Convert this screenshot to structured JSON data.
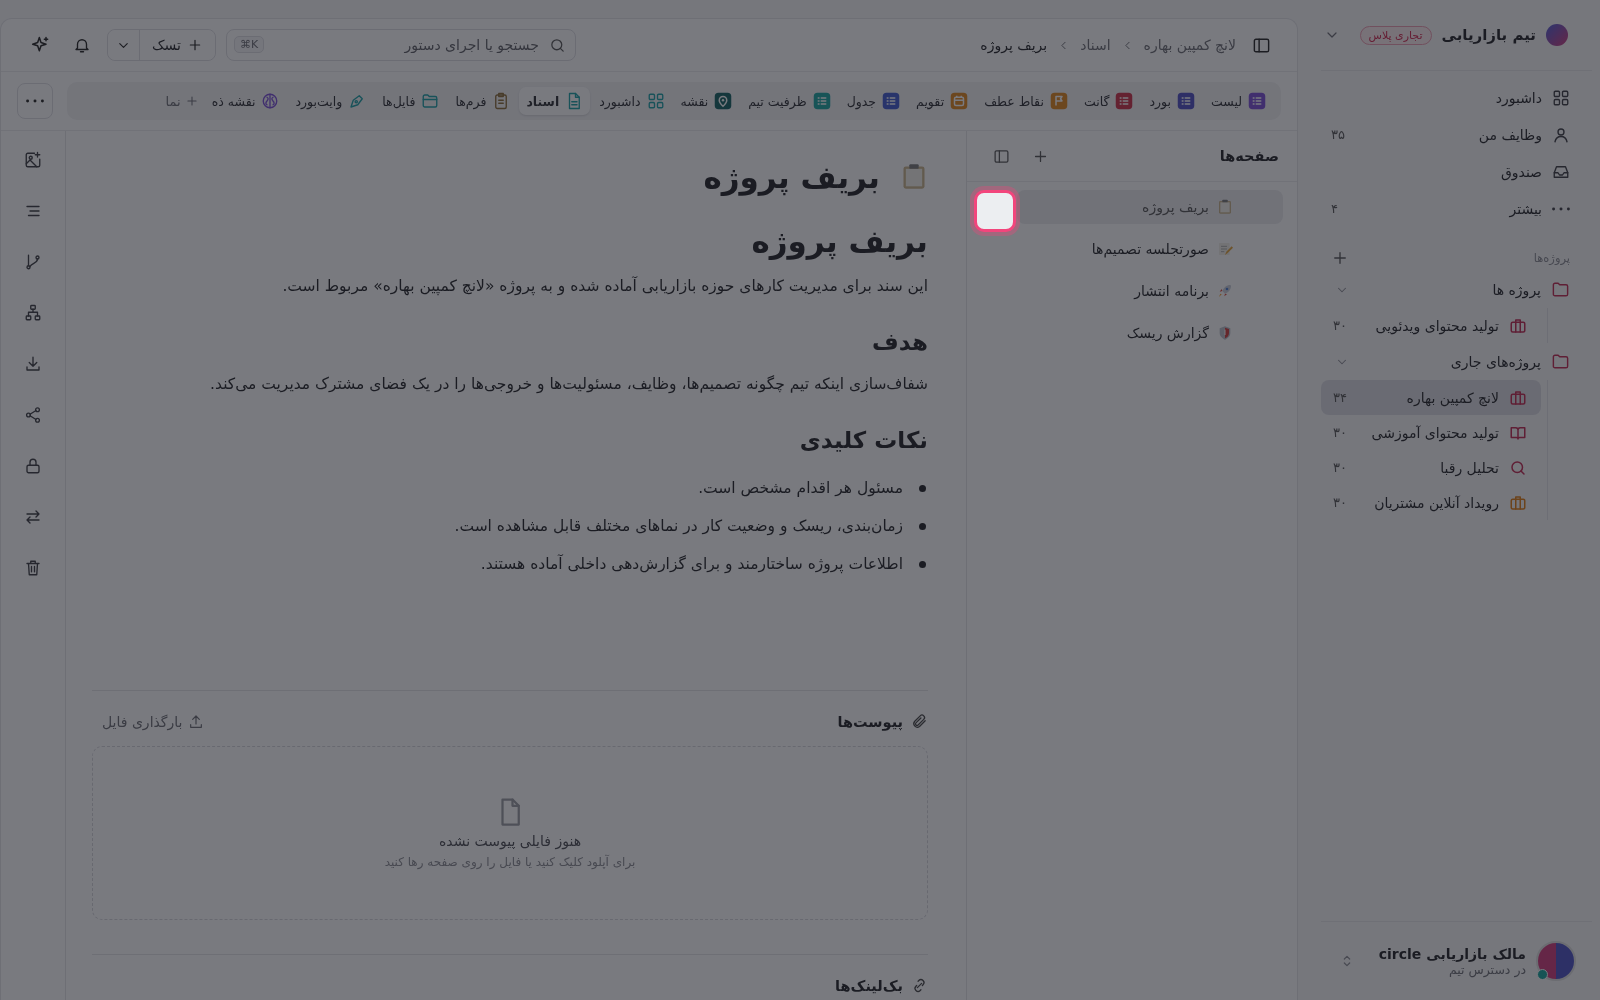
{
  "sidebar": {
    "team": {
      "name": "تیم بازاریابی",
      "badge": "تجاری پلاس"
    },
    "nav": [
      {
        "label": "داشبورد",
        "kind": "grid"
      },
      {
        "label": "وظایف من",
        "count": "۳۵",
        "kind": "user"
      },
      {
        "label": "صندوق",
        "kind": "inbox"
      },
      {
        "label": "بیشتر",
        "count": "۴",
        "kind": "more"
      }
    ],
    "projects_heading": "پروژه‌ها",
    "folders": [
      {
        "label": "پروژه ها",
        "expanded": true,
        "children": [
          {
            "label": "تولید محتوای ویدئویی",
            "count": "۳۰",
            "kind": "briefcase",
            "color": "#5f1f35",
            "selected": false
          }
        ]
      },
      {
        "label": "پروژه‌های جاری",
        "expanded": true,
        "children": [
          {
            "label": "لانچ کمپین بهاره",
            "count": "۳۴",
            "kind": "briefcase",
            "color": "#5f1f35",
            "selected": true
          },
          {
            "label": "تولید محتوای آموزشی",
            "count": "۳۰",
            "kind": "book",
            "color": "#5f1f35",
            "selected": false
          },
          {
            "label": "تحلیل رقبا",
            "count": "۳۰",
            "kind": "search",
            "color": "#5f1f35",
            "selected": false
          },
          {
            "label": "رویداد آنلاین مشتریان",
            "count": "۳۰",
            "kind": "briefcase",
            "color": "#6c431b",
            "selected": false
          }
        ]
      }
    ],
    "user": {
      "name": "مالک بازاریابی circle",
      "status": "در دسترس تیم"
    }
  },
  "topbar": {
    "breadcrumbs": [
      "لانچ کمپین بهاره",
      "اسناد",
      "بریف پروژه"
    ],
    "search": {
      "placeholder": "جستجو یا اجرای دستور",
      "shortcut": "⌘K"
    },
    "new_task": "تسک"
  },
  "views": {
    "tabs": [
      {
        "label": "لیست",
        "kind": "list",
        "color": "#41306e",
        "selected": false
      },
      {
        "label": "بورد",
        "kind": "list",
        "color": "#2e3066",
        "selected": false
      },
      {
        "label": "گانت",
        "kind": "list",
        "color": "#642331",
        "selected": false
      },
      {
        "label": "نقاط عطف",
        "kind": "flag",
        "color": "#6c471f",
        "selected": false
      },
      {
        "label": "تقویم",
        "kind": "calendar",
        "color": "#6c471f",
        "selected": false
      },
      {
        "label": "جدول",
        "kind": "list",
        "color": "#28356b",
        "selected": false
      },
      {
        "label": "ظرفیت تیم",
        "kind": "list",
        "color": "#185457",
        "selected": false
      },
      {
        "label": "نقشه",
        "kind": "pin",
        "color": "#15383c",
        "selected": false
      },
      {
        "label": "داشبورد",
        "kind": "dashboard",
        "color": "#195259",
        "selected": false
      },
      {
        "label": "اسناد",
        "kind": "doc",
        "color": "#195259",
        "selected": true
      },
      {
        "label": "فرم‌ها",
        "kind": "form",
        "color": "#483c2a",
        "selected": false
      },
      {
        "label": "فایل‌ها",
        "kind": "folder",
        "color": "#195259",
        "selected": false
      },
      {
        "label": "وایت‌بورد",
        "kind": "pen",
        "color": "#195259",
        "selected": false
      },
      {
        "label": "نقشه ذه",
        "kind": "brain",
        "color": "#41306e",
        "selected": false
      }
    ],
    "add_view": "نما"
  },
  "pages": {
    "title": "صفحه‌ها",
    "items": [
      {
        "label": "بریف پروژه",
        "kind": "clipboard",
        "selected": true
      },
      {
        "label": "صورتجلسه تصمیم‌ها",
        "kind": "memo",
        "selected": false
      },
      {
        "label": "برنامه انتشار",
        "kind": "rocket",
        "selected": false
      },
      {
        "label": "گزارش ریسک",
        "kind": "shield",
        "selected": false
      }
    ]
  },
  "document": {
    "title": "بریف پروژه",
    "blocks": [
      {
        "kind": "h1",
        "text": "بریف پروژه"
      },
      {
        "kind": "p",
        "text": "این سند برای مدیریت کارهای حوزه بازاریابی آماده شده و به پروژه «لانچ کمپین بهاره» مربوط است."
      },
      {
        "kind": "h2",
        "text": "هدف"
      },
      {
        "kind": "p",
        "text": "شفاف‌سازی اینکه تیم چگونه تصمیم‌ها، وظایف، مسئولیت‌ها و خروجی‌ها را در یک فضای مشترک مدیریت می‌کند."
      },
      {
        "kind": "h2",
        "text": "نکات کلیدی"
      },
      {
        "kind": "bullet",
        "text": "مسئول هر اقدام مشخص است."
      },
      {
        "kind": "bullet",
        "text": "زمان‌بندی، ریسک و وضعیت کار در نماهای مختلف قابل مشاهده است."
      },
      {
        "kind": "bullet",
        "text": "اطلاعات پروژه ساختارمند و برای گزارش‌دهی داخلی آماده هستند."
      }
    ],
    "attachments": {
      "title": "پیوست‌ها",
      "upload": "بارگذاری فایل",
      "empty_title": "هنوز فایلی پیوست نشده",
      "empty_hint": "برای آپلود کلیک کنید یا فایل را روی صفحه رها کنید"
    },
    "backlinks": {
      "title": "بک‌لینک‌ها"
    }
  }
}
